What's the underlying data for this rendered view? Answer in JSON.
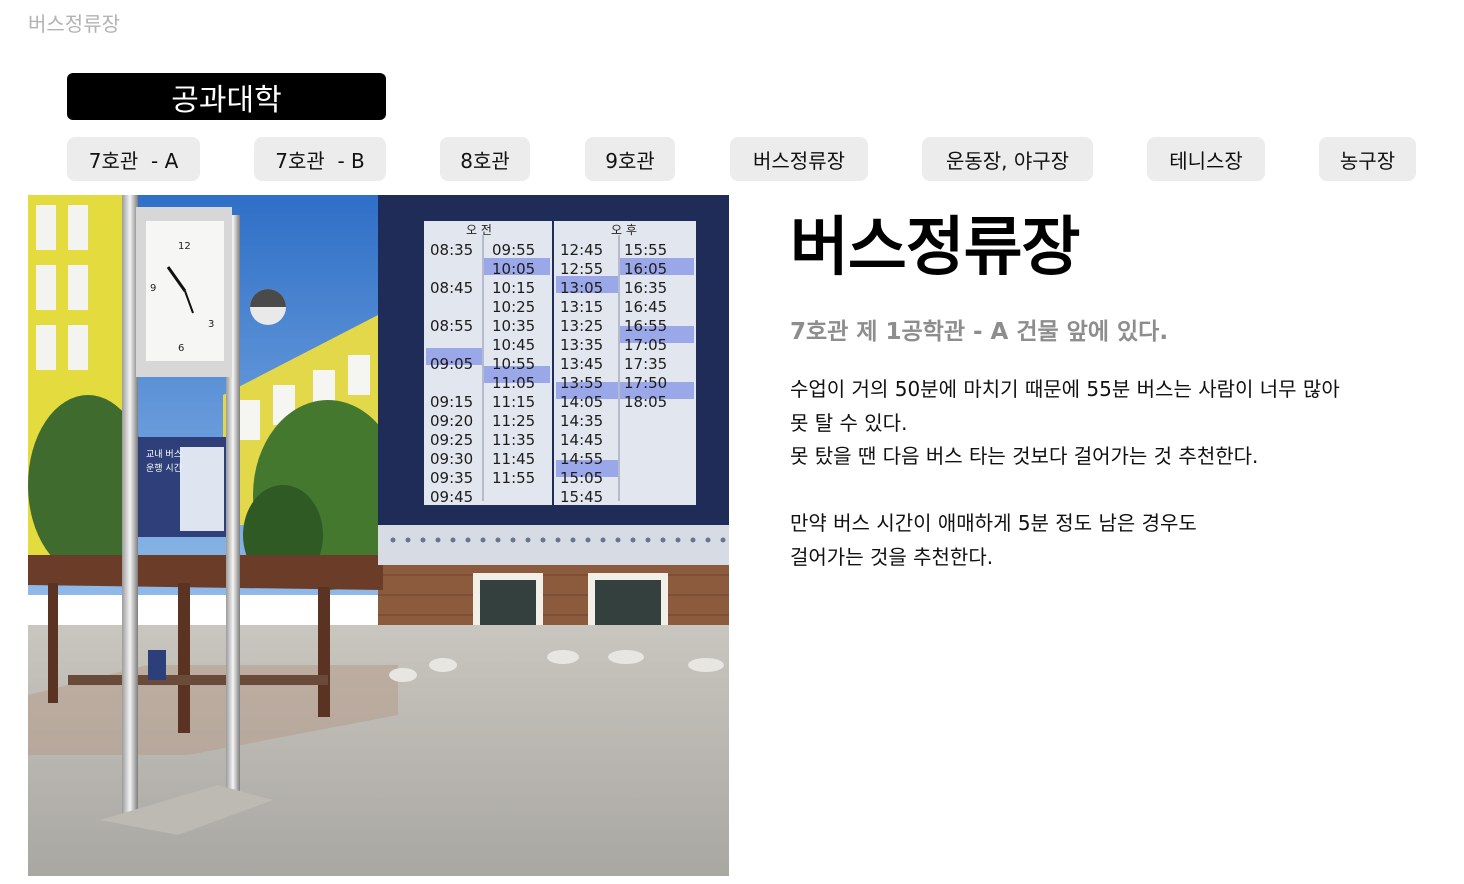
{
  "header": {
    "page_label": "버스정류장"
  },
  "college_button": "공과대학",
  "tabs": [
    {
      "label": "7호관  - A"
    },
    {
      "label": "7호관  - B"
    },
    {
      "label": "8호관"
    },
    {
      "label": "9호관"
    },
    {
      "label": "버스정류장"
    },
    {
      "label": "운동장, 야구장"
    },
    {
      "label": "테니스장"
    },
    {
      "label": "농구장"
    }
  ],
  "photo": {
    "campus_sign": {
      "line1": "교내 버스",
      "line2": "운행 시간"
    },
    "schedule": {
      "am_header": "오 전",
      "pm_header": "오 후",
      "am_col1": [
        "08:35",
        "",
        "08:45",
        "",
        "08:55",
        "",
        "09:05",
        "",
        "09:15",
        "09:20",
        "09:25",
        "09:30",
        "09:35",
        "09:45"
      ],
      "am_col2": [
        "09:55",
        "10:05",
        "10:15",
        "10:25",
        "10:35",
        "10:45",
        "10:55",
        "11:05",
        "11:15",
        "11:25",
        "11:35",
        "11:45",
        "11:55",
        ""
      ],
      "pm_col1": [
        "12:45",
        "12:55",
        "13:05",
        "13:15",
        "13:25",
        "13:35",
        "13:45",
        "13:55",
        "14:05",
        "14:35",
        "14:45",
        "14:55",
        "15:05",
        "15:45"
      ],
      "pm_col2": [
        "15:55",
        "16:05",
        "16:35",
        "16:45",
        "16:55",
        "17:05",
        "17:35",
        "17:50",
        "18:05",
        "",
        "",
        "",
        "",
        ""
      ]
    }
  },
  "content": {
    "title": "버스정류장",
    "subtitle": "7호관 제 1공학관 - A 건물 앞에 있다.",
    "para1_line1": "수업이 거의 50분에 마치기 때문에 55분 버스는 사람이 너무 많아",
    "para1_line2": "못 탈 수 있다.",
    "para1_line3": "못 탔을 땐 다음 버스 타는 것보다 걸어가는 것 추천한다.",
    "para2_line1": "만약 버스 시간이 애매하게 5분 정도 남은 경우도",
    "para2_line2": "걸어가는 것을 추천한다."
  },
  "colors": {
    "accent": "#000000",
    "tab_bg": "#ececec",
    "muted": "#8d8d8d",
    "highlight": "#9aa7e8"
  }
}
